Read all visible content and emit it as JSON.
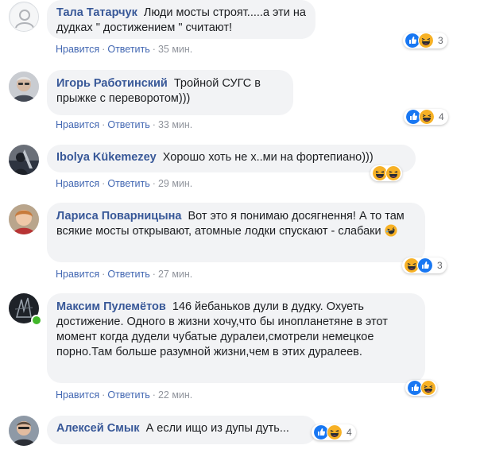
{
  "comments": [
    {
      "author": "Тала Татарчук",
      "text": "Люди мосты строят.....а эти на дудках \" достижением \" считают!",
      "reactions": [
        "like",
        "haha"
      ],
      "reaction_count": "3",
      "like": "Нравится",
      "reply": "Ответить",
      "time": "35 мин."
    },
    {
      "author": "Игорь Работинский",
      "text": "Тройной СУГС в прыжке с переворотом)))",
      "reactions": [
        "like",
        "haha"
      ],
      "reaction_count": "4",
      "like": "Нравится",
      "reply": "Ответить",
      "time": "33 мин."
    },
    {
      "author": "Ibolya Kükemezey",
      "text": "Хорошо хоть не х..ми на фортепиано)))",
      "reactions": [
        "haha",
        "haha"
      ],
      "reaction_count": "",
      "like": "Нравится",
      "reply": "Ответить",
      "time": "29 мин."
    },
    {
      "author": "Лариса Поварницына",
      "text": "Вот это я понимаю досягнення! А то там всякие мосты открывают, атомные лодки спускают - слабаки",
      "reactions": [
        "haha",
        "like"
      ],
      "reaction_count": "3",
      "like": "Нравится",
      "reply": "Ответить",
      "time": "27 мин."
    },
    {
      "author": "Максим Пулемётов",
      "text": "146 йебаньков дули в дудку. Охуеть достижение. Одного в жизни хочу,что бы инопланетяне в этот момент когда дудели чубатые дуралеи,смотрели немецкое порно.Там больше разумной жизни,чем в этих дуралеев.",
      "reactions": [
        "like",
        "haha"
      ],
      "reaction_count": "",
      "like": "Нравится",
      "reply": "Ответить",
      "time": "22 мин."
    },
    {
      "author": "Алексей Смык",
      "text": "А если ищо из дупы дуть...",
      "reactions": [
        "like",
        "haha"
      ],
      "reaction_count": "4",
      "like": "",
      "reply": "",
      "time": ""
    }
  ],
  "colors": {
    "author": "#385898",
    "link": "#4267b2",
    "bubble": "#f2f3f5",
    "like": "#1877f2",
    "haha": "#f7b125",
    "online": "#42b72a"
  }
}
